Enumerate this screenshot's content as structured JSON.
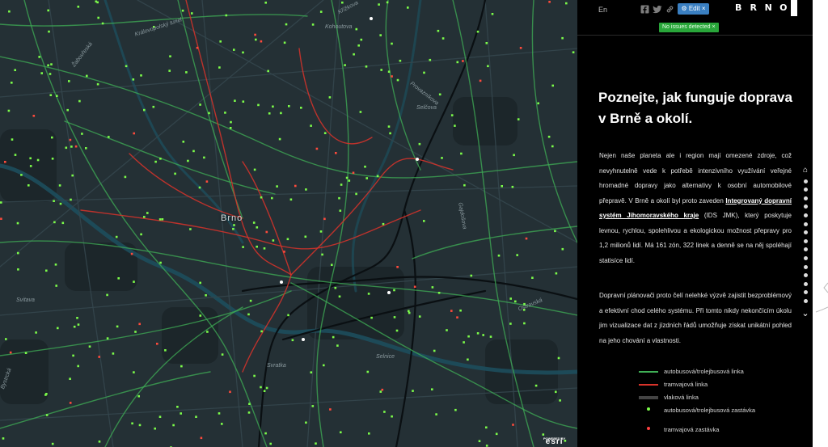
{
  "map": {
    "city_label": "Brno",
    "street_labels": [
      {
        "text": "Křížkova"
      },
      {
        "text": "Kohoutova"
      },
      {
        "text": "Královopolský tunel"
      },
      {
        "text": "Žabovřeská"
      },
      {
        "text": "Provazníkova"
      },
      {
        "text": "Selčova"
      },
      {
        "text": "Gajdošova"
      },
      {
        "text": "Ostravská"
      },
      {
        "text": "Svratka"
      },
      {
        "text": "Selnice"
      },
      {
        "text": "Bystrcká"
      },
      {
        "text": "Svitava"
      }
    ],
    "powered_by": "POWERED BY",
    "powered_logo": "esri",
    "colors": {
      "background": "#243035",
      "bus_line": "#3fae55",
      "tram_line": "#d8332a",
      "rail_line": "#0a0f12",
      "stop": "#7cfc4a",
      "river": "#1d4e5c"
    }
  },
  "panel": {
    "language": "En",
    "social_icons": [
      "facebook-icon",
      "twitter-icon",
      "link-icon"
    ],
    "edit_label": "Edit",
    "edit_close": "×",
    "issues_label": "No issues detected",
    "issues_close": "×",
    "logo_letters": [
      "B",
      "R",
      "N",
      "O"
    ],
    "headline": "Poznejte, jak funguje doprava v Brně a okolí.",
    "paragraph1_before": "Nejen naše planeta ale i region mají omezené zdroje, což nevyhnutelně vede k potřebě intenzivního využívání veřejné hromadné dopravy jako alternativy k osobní automobilové přepravě. V Brně a okolí byl proto zaveden ",
    "paragraph1_link": "Integrovaný dopravní systém Jihomoravského kraje",
    "paragraph1_after": " (IDS JMK), který poskytuje levnou, rychlou, spolehlivou a ekologickou možnost přepravy pro 1,2 milionů lidí. Má 161 zón, 322 linek a denně se na něj spoléhají statisíce lidí.",
    "paragraph2": "Dopravní plánovači proto čelí nelehké výzvě zajistit bezproblémový a efektivní chod celého systému. Při tomto nikdy nekončícím úkolu jim vizualizace dat z jízdních řádů umožňuje získat unikátní pohled na jeho chování a vlastnosti.",
    "legend": [
      {
        "label": "autobusová/trolejbusová linka",
        "color": "#3fae55"
      },
      {
        "label": "tramvajová linka",
        "color": "#d8332a"
      },
      {
        "label": "vlaková linka",
        "color": "#444444"
      },
      {
        "label": "autobusová/trolejbusová zastávka",
        "color": "#7cfc4a"
      },
      {
        "label": "tramvajová zastávka",
        "color": "#ff4040"
      }
    ],
    "nav_dots": 15
  }
}
